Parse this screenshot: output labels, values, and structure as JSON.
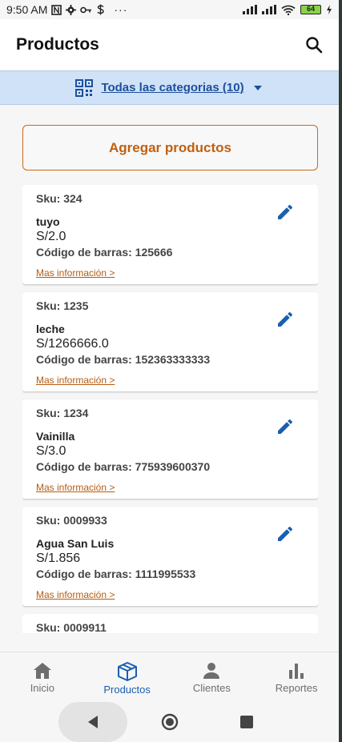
{
  "status_bar": {
    "time": "9:50 AM",
    "left_icons": [
      "notification-n-icon",
      "gear-icon",
      "key-icon",
      "dollar-icon",
      "more-dots-icon"
    ],
    "battery": "64",
    "right_icons": [
      "signal-icon",
      "signal-icon",
      "wifi-icon",
      "battery-icon",
      "charging-icon"
    ]
  },
  "app_bar": {
    "title": "Productos",
    "search_icon": "search-icon"
  },
  "filter": {
    "icon": "qr-code-icon",
    "label": "Todas las categorias (10)",
    "dropdown_icon": "chevron-down-icon"
  },
  "add_button": {
    "label": "Agregar productos"
  },
  "products": [
    {
      "sku": "Sku: 324",
      "name": "tuyo",
      "price": "S/2.0",
      "barcode": "Código de barras: 125666",
      "more": "Mas información >"
    },
    {
      "sku": "Sku: 1235",
      "name": "leche",
      "price": "S/1266666.0",
      "barcode": "Código de barras: 152363333333",
      "more": "Mas información >"
    },
    {
      "sku": "Sku: 1234",
      "name": "Vainilla",
      "price": "S/3.0",
      "barcode": "Código de barras: 775939600370",
      "more": "Mas información >"
    },
    {
      "sku": "Sku: 0009933",
      "name": "Agua San Luis",
      "price": "S/1.856",
      "barcode": "Código de barras: 1111995533",
      "more": "Mas información >"
    },
    {
      "sku": "Sku: 0009911",
      "name": "",
      "price": "",
      "barcode": "",
      "more": ""
    }
  ],
  "bottom_nav": [
    {
      "label": "Inicio",
      "icon": "home-icon",
      "active": false
    },
    {
      "label": "Productos",
      "icon": "box-icon",
      "active": true
    },
    {
      "label": "Clientes",
      "icon": "person-icon",
      "active": false
    },
    {
      "label": "Reportes",
      "icon": "bar-chart-icon",
      "active": false
    }
  ],
  "system_nav": [
    "back-icon",
    "home-circle-icon",
    "recents-icon"
  ],
  "colors": {
    "accent_blue": "#1b5fb0",
    "filter_bg": "#cfe2f8",
    "orange": "#c05f10"
  }
}
